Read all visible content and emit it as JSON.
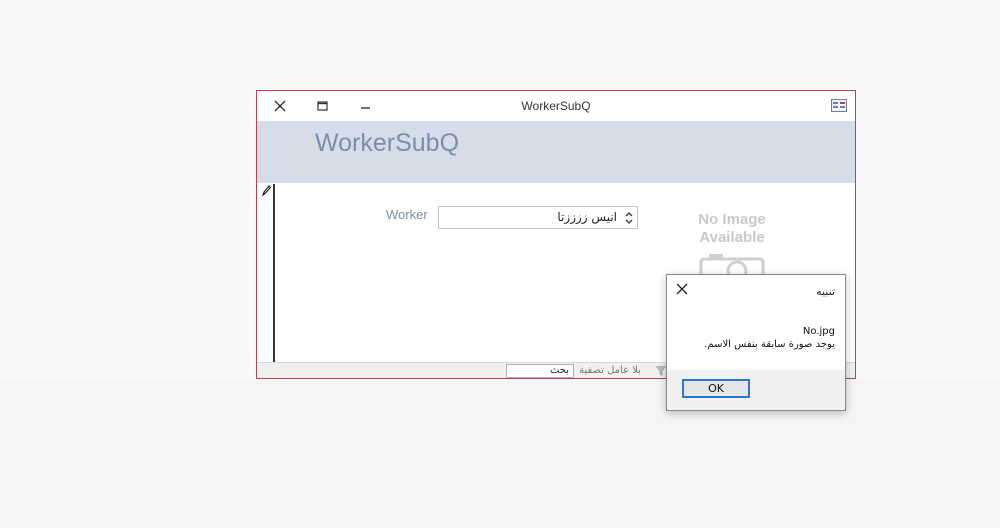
{
  "form": {
    "window_title": "WorkerSubQ",
    "header_title": "WorkerSubQ",
    "worker_label": "Worker",
    "worker_value": "انيس ززززتا",
    "image_placeholder_line1": "No Image",
    "image_placeholder_line2": "Available",
    "status": {
      "filter_label": "بلا عامل تصفية",
      "search_value": "بحث"
    }
  },
  "dialog": {
    "title": "تنبيه",
    "message_line1": "No.jpg",
    "message_line2": "يوجد صورة سابقة بنفس الاسم.",
    "ok_label": "OK"
  },
  "colors": {
    "window_border": "#b8434c",
    "header_band": "#d6dde8",
    "header_text": "#7a8fab",
    "ok_border": "#2a78d6"
  }
}
